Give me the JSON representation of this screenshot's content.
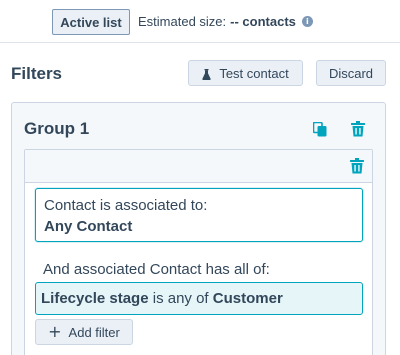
{
  "topbar": {
    "active_list_label": "Active list",
    "estimated_prefix": "Estimated size:",
    "estimated_value": "-- contacts",
    "info_icon": "info-icon",
    "info_glyph": "i"
  },
  "filters": {
    "title": "Filters",
    "test_contact_label": "Test contact",
    "discard_label": "Discard"
  },
  "group": {
    "title": "Group 1",
    "association": {
      "line1": "Contact is associated to:",
      "line2": "Any Contact"
    },
    "and_text": "And associated Contact has all of:",
    "criteria": {
      "property": "Lifecycle stage",
      "operator": "is any of",
      "value": "Customer"
    },
    "add_filter_label": "Add filter",
    "add_glyph": "+"
  },
  "colors": {
    "accent_teal": "#00a4bd",
    "text": "#33475b",
    "button_bg": "#eaf0f6",
    "border": "#cbd6e2"
  }
}
